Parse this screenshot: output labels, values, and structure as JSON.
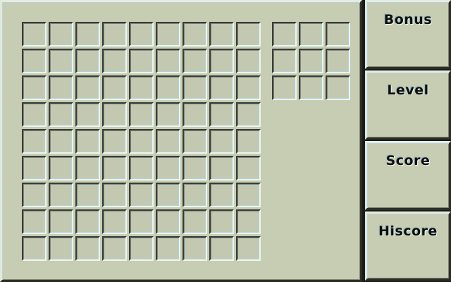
{
  "board": {
    "rows": 9,
    "cols": 9
  },
  "preview": {
    "rows": 3,
    "cols": 3
  },
  "sidebar": {
    "bonus_label": "Bonus",
    "level_label": "Level",
    "score_label": "Score",
    "hiscore_label": "Hiscore"
  },
  "colors": {
    "panel": "#c7cdb3",
    "cell": "#c3c9b0",
    "highlight": "#e6ece0",
    "shadow": "#2c2f27",
    "accent_glow": "#a9d4e0"
  }
}
